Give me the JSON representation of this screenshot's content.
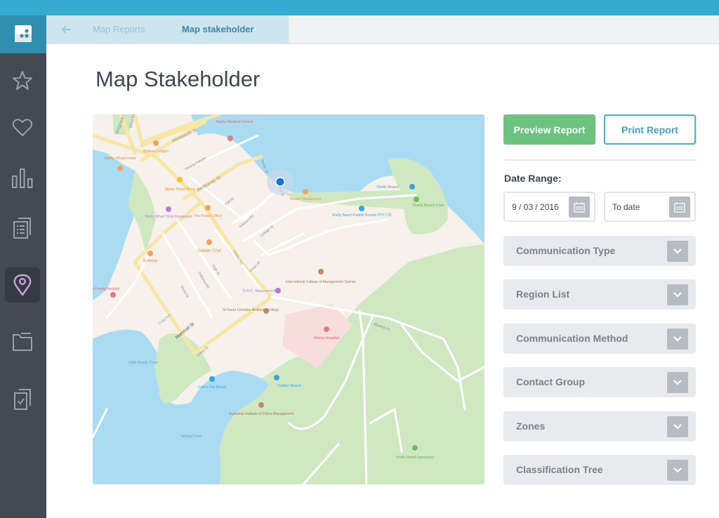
{
  "colors": {
    "topbar": "#35abcf",
    "sidebar": "#434a54",
    "accent_green": "#6cc37f",
    "accent_blue": "#49b0cf",
    "active_icon": "#c9a3dc"
  },
  "sidebar": {
    "logo": "app-logo",
    "items": [
      {
        "name": "favorites",
        "icon": "star-icon",
        "active": false
      },
      {
        "name": "likes",
        "icon": "heart-icon",
        "active": false
      },
      {
        "name": "reports",
        "icon": "bar-chart-icon",
        "active": false
      },
      {
        "name": "documents",
        "icon": "document-list-icon",
        "active": false
      },
      {
        "name": "map",
        "icon": "map-pin-icon",
        "active": true
      },
      {
        "name": "files",
        "icon": "folder-icon",
        "active": false
      },
      {
        "name": "tasks",
        "icon": "checklist-icon",
        "active": false
      }
    ]
  },
  "breadcrumb": {
    "back_icon": "arrow-left-icon",
    "items": [
      "Map Reports",
      "Map stakeholder"
    ]
  },
  "page": {
    "title": "Map Stakeholder"
  },
  "actions": {
    "preview_label": "Preview Report",
    "print_label": "Print Report"
  },
  "date_range": {
    "label": "Date Range:",
    "from_value": "9 / 03 / 2016",
    "to_value": "To date",
    "calendar_icon": "calendar-icon"
  },
  "filters": [
    {
      "label": "Communication Type"
    },
    {
      "label": "Region List"
    },
    {
      "label": "Communication Method"
    },
    {
      "label": "Contact Group"
    },
    {
      "label": "Zones"
    },
    {
      "label": "Classification Tree"
    }
  ],
  "map": {
    "streets": [
      "Belgrave St",
      "Whistler St",
      "Wentworth St",
      "Victoria Parade",
      "Ashburner St",
      "Bower St",
      "Reddall St",
      "Cliff St",
      "Addison Rd",
      "College St",
      "Darley Rd",
      "Vivian St",
      "High St",
      "Osborne Rd",
      "Wood St",
      "Marshall St",
      "Carey St",
      "Craig Ave",
      "Bluefish Dr"
    ],
    "places": [
      {
        "name": "Manly Medical Centre",
        "type": "medical"
      },
      {
        "name": "Bakers Delight",
        "type": "food"
      },
      {
        "name": "Manly Wharf Hotel",
        "type": "food"
      },
      {
        "name": "Manly Food Shop",
        "type": "food"
      },
      {
        "name": "Manly Wharf Hotel Restaurant",
        "type": "nightlife"
      },
      {
        "name": "The Roast Office",
        "type": "food"
      },
      {
        "name": "Golden Chef",
        "type": "food"
      },
      {
        "name": "Subway",
        "type": "food"
      },
      {
        "name": "Bower Restaurant",
        "type": "food"
      },
      {
        "name": "Shelly Beach",
        "type": "beach"
      },
      {
        "name": "Shelly Beach Park",
        "type": "park"
      },
      {
        "name": "Shelly Beach Paddle Boards PTY LTD",
        "type": "beach"
      },
      {
        "name": "S.R.C. Basement Bar",
        "type": "nightlife"
      },
      {
        "name": "International College of Management Sydney",
        "type": "school"
      },
      {
        "name": "St Paul's Christian Brother's College",
        "type": "school"
      },
      {
        "name": "Manly Hospital",
        "type": "medical"
      },
      {
        "name": "Waters Private Hospital",
        "type": "medical"
      },
      {
        "name": "Little Manly Cove",
        "type": "water"
      },
      {
        "name": "Collins Flat Beach",
        "type": "beach"
      },
      {
        "name": "Collins Beach",
        "type": "beach"
      },
      {
        "name": "Australian Institute of Police Management",
        "type": "school"
      },
      {
        "name": "Spring Cove",
        "type": "water"
      },
      {
        "name": "North Head Sanctuary",
        "type": "park"
      }
    ]
  }
}
